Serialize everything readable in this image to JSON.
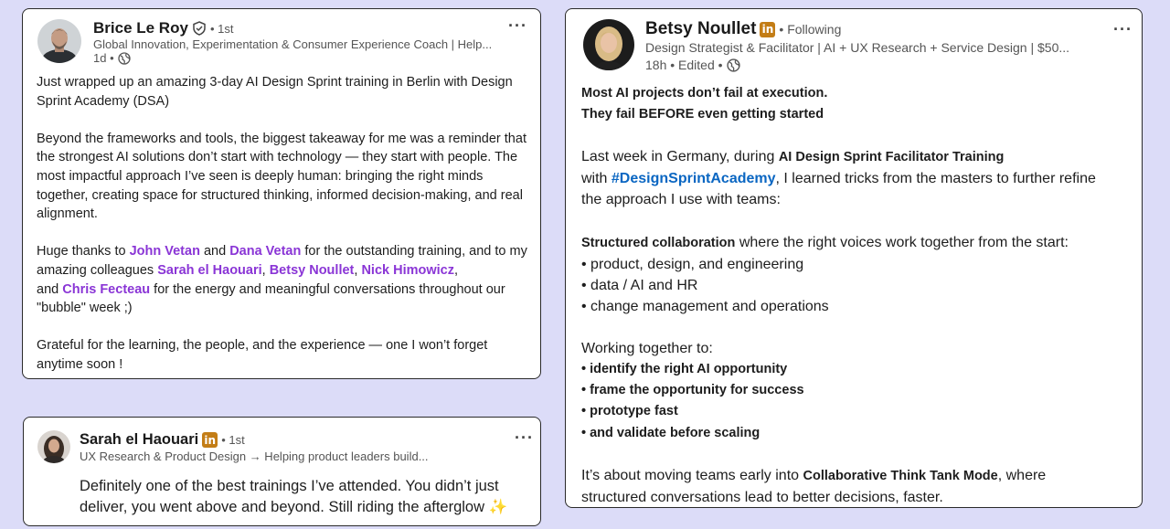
{
  "post_brice": {
    "name": "Brice Le Roy",
    "degree": "• 1st",
    "headline": "Global Innovation, Experimentation & Consumer Experience Coach | Help...",
    "meta": "1d •",
    "more": "···",
    "p1": "Just wrapped up an amazing 3-day AI Design Sprint training in Berlin with Design Sprint Academy (DSA)",
    "p2": "Beyond the frameworks and tools, the biggest takeaway for me was a reminder that the strongest AI solutions don’t start with technology — they start with people. The most impactful approach I’ve seen is deeply human: bringing the right minds together, creating space for structured thinking, informed decision-making, and real alignment.",
    "p3_a": "Huge thanks to ",
    "m1": "John Vetan",
    "p3_b": " and ",
    "m2": "Dana Vetan",
    "p3_c": " for the outstanding training, and to my amazing colleagues ",
    "m3": "Sarah el Haouari",
    "p3_d": ", ",
    "m4": "Betsy Noullet",
    "p3_e": ", ",
    "m5": "Nick Himowicz",
    "p3_f": ",",
    "p3_g": "and ",
    "m6": "Chris Fecteau",
    "p3_h": " for the energy and meaningful conversations throughout our \"bubble\" week ;)",
    "p4": "Grateful for the learning, the people, and the experience — one I won’t forget anytime soon !"
  },
  "comment_sarah": {
    "name": "Sarah el Haouari",
    "badge": "in",
    "degree": "• 1st",
    "headline": "UX Research & Product Design → Helping product leaders build...",
    "more": "···",
    "text": "Definitely one of the best trainings I’ve attended. You didn’t just deliver, you went above and beyond. Still riding the afterglow ",
    "sparkle": "✨"
  },
  "post_betsy": {
    "name": "Betsy Noullet",
    "badge": "in",
    "degree": "• Following",
    "headline": "Design Strategist & Facilitator | AI + UX Research + Service Design | $50...",
    "meta": "18h • Edited •",
    "more": "···",
    "h1": "Most AI projects don’t fail at execution.",
    "h2": "They fail BEFORE even getting started",
    "l1_a": "Last week in Germany, during ",
    "l1_b": "AI Design Sprint Facilitator Training",
    "l2_a": "with ",
    "l2_hashtag": "#DesignSprintAcademy",
    "l2_b": ", I learned tricks from the masters to further refine",
    "l3": "the approach I use with teams:",
    "s1_a": "Structured collaboration",
    "s1_b": " where the right voices work together from the start:",
    "b1": "• product, design, and engineering",
    "b2": "• data / AI and HR",
    "b3": "• change management and operations",
    "w0": "Working together to:",
    "w1": "• identify the right AI opportunity",
    "w2": "• frame the opportunity for success",
    "w3": "• prototype fast",
    "w4": "• and validate before scaling",
    "e1_a": "It’s about moving teams early into ",
    "e1_b": "Collaborative Think Tank Mode",
    "e1_c": ", where",
    "e2": "structured conversations lead to better decisions, faster."
  }
}
